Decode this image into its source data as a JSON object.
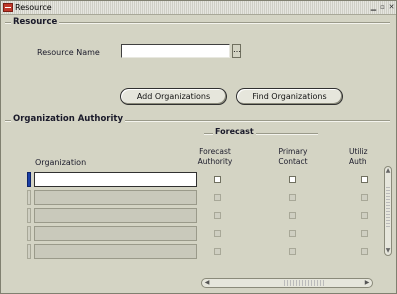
{
  "window": {
    "title": "Resource"
  },
  "resource_section": {
    "heading": "Resource",
    "resource_name_label": "Resource Name",
    "resource_name_value": ""
  },
  "buttons": {
    "add_organizations": "Add Organizations",
    "find_organizations": "Find Organizations"
  },
  "org_section": {
    "heading": "Organization Authority",
    "forecast_group": "Forecast",
    "columns": {
      "organization": "Organization",
      "forecast_authority": "Forecast\nAuthority",
      "primary_contact": "Primary\nContact",
      "utilization_authority": "Utiliz\nAuth"
    },
    "rows": [
      {
        "organization": "",
        "forecast_authority": false,
        "primary_contact": false,
        "utilization_authority": false
      },
      {
        "organization": "",
        "forecast_authority": false,
        "primary_contact": false,
        "utilization_authority": false
      },
      {
        "organization": "",
        "forecast_authority": false,
        "primary_contact": false,
        "utilization_authority": false
      },
      {
        "organization": "",
        "forecast_authority": false,
        "primary_contact": false,
        "utilization_authority": false
      },
      {
        "organization": "",
        "forecast_authority": false,
        "primary_contact": false,
        "utilization_authority": false
      }
    ]
  },
  "icons": {
    "app": "oracle-forms-app-icon",
    "lov": "lov-ellipsis-icon"
  },
  "colors": {
    "background": "#d4d4c4",
    "active_row": "#1a3fa6"
  }
}
